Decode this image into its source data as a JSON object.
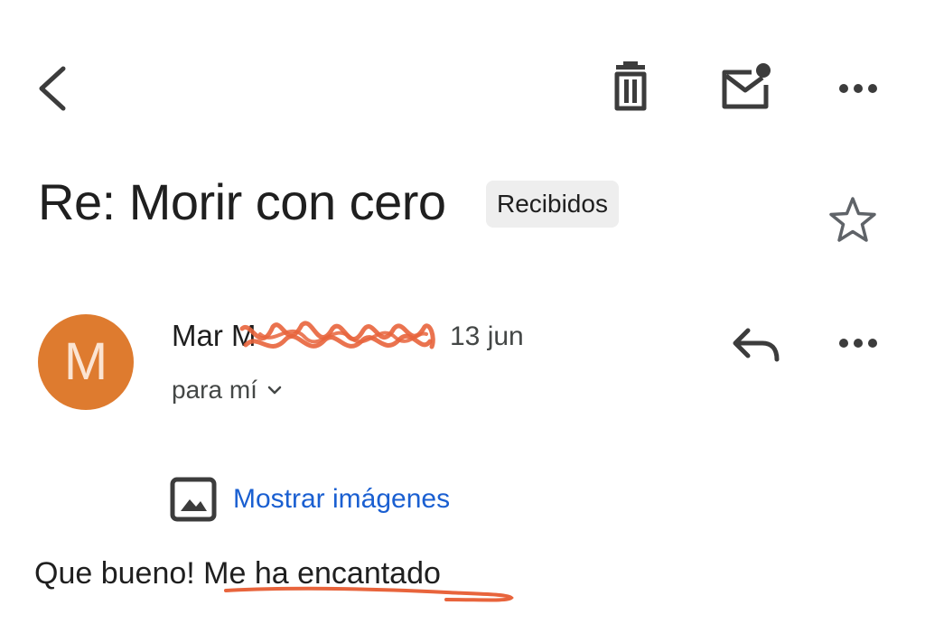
{
  "toolbar": {
    "back_icon": "chevron-left-icon",
    "delete_icon": "trash-icon",
    "mark_unread_icon": "mail-unread-icon",
    "more_icon": "more-horizontal-icon"
  },
  "email": {
    "subject": "Re: Morir con cero",
    "label": "Recibidos",
    "starred": false,
    "sender": {
      "avatar_letter": "M",
      "avatar_color": "#de7b2f",
      "name": "Mar M",
      "date": "13 jun",
      "recipient": "para mí"
    },
    "show_images_label": "Mostrar imágenes",
    "body": {
      "text_plain": "Que bueno! ",
      "text_highlighted": "Me ha encantado"
    }
  },
  "colors": {
    "annotation": "#e8643c",
    "link": "#1a5fd1",
    "chip_background": "#eeeeee"
  }
}
